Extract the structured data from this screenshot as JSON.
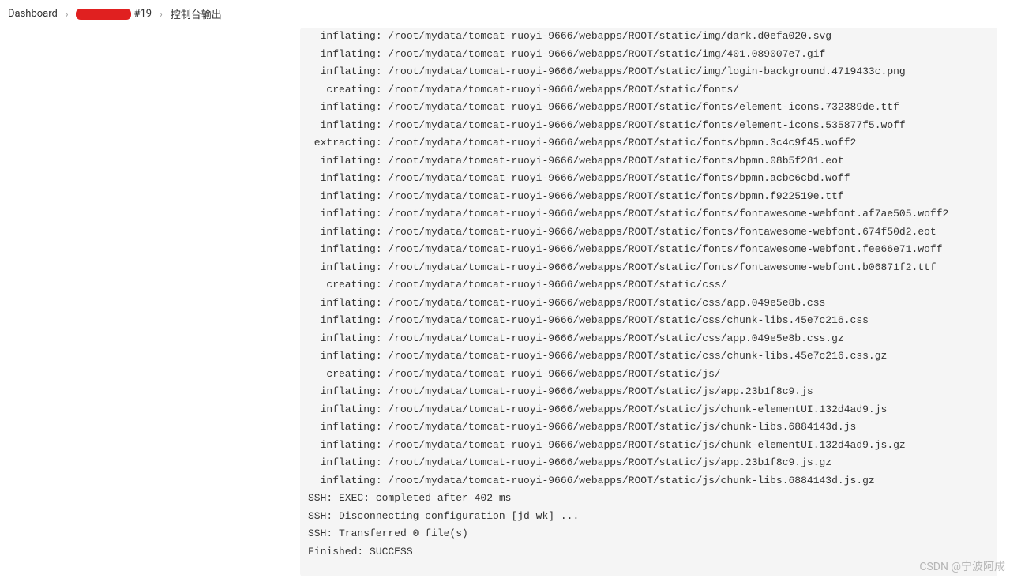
{
  "breadcrumb": {
    "items": [
      {
        "label": "Dashboard",
        "redacted": false
      },
      {
        "label": "#19",
        "redacted": true
      },
      {
        "label": "控制台输出",
        "redacted": false
      }
    ],
    "separator": "›"
  },
  "console": {
    "lines": [
      "  inflating: /root/mydata/tomcat-ruoyi-9666/webapps/ROOT/static/img/dark.d0efa020.svg",
      "  inflating: /root/mydata/tomcat-ruoyi-9666/webapps/ROOT/static/img/401.089007e7.gif",
      "  inflating: /root/mydata/tomcat-ruoyi-9666/webapps/ROOT/static/img/login-background.4719433c.png",
      "   creating: /root/mydata/tomcat-ruoyi-9666/webapps/ROOT/static/fonts/",
      "  inflating: /root/mydata/tomcat-ruoyi-9666/webapps/ROOT/static/fonts/element-icons.732389de.ttf",
      "  inflating: /root/mydata/tomcat-ruoyi-9666/webapps/ROOT/static/fonts/element-icons.535877f5.woff",
      " extracting: /root/mydata/tomcat-ruoyi-9666/webapps/ROOT/static/fonts/bpmn.3c4c9f45.woff2",
      "  inflating: /root/mydata/tomcat-ruoyi-9666/webapps/ROOT/static/fonts/bpmn.08b5f281.eot",
      "  inflating: /root/mydata/tomcat-ruoyi-9666/webapps/ROOT/static/fonts/bpmn.acbc6cbd.woff",
      "  inflating: /root/mydata/tomcat-ruoyi-9666/webapps/ROOT/static/fonts/bpmn.f922519e.ttf",
      "  inflating: /root/mydata/tomcat-ruoyi-9666/webapps/ROOT/static/fonts/fontawesome-webfont.af7ae505.woff2",
      "  inflating: /root/mydata/tomcat-ruoyi-9666/webapps/ROOT/static/fonts/fontawesome-webfont.674f50d2.eot",
      "  inflating: /root/mydata/tomcat-ruoyi-9666/webapps/ROOT/static/fonts/fontawesome-webfont.fee66e71.woff",
      "  inflating: /root/mydata/tomcat-ruoyi-9666/webapps/ROOT/static/fonts/fontawesome-webfont.b06871f2.ttf",
      "   creating: /root/mydata/tomcat-ruoyi-9666/webapps/ROOT/static/css/",
      "  inflating: /root/mydata/tomcat-ruoyi-9666/webapps/ROOT/static/css/app.049e5e8b.css",
      "  inflating: /root/mydata/tomcat-ruoyi-9666/webapps/ROOT/static/css/chunk-libs.45e7c216.css",
      "  inflating: /root/mydata/tomcat-ruoyi-9666/webapps/ROOT/static/css/app.049e5e8b.css.gz",
      "  inflating: /root/mydata/tomcat-ruoyi-9666/webapps/ROOT/static/css/chunk-libs.45e7c216.css.gz",
      "   creating: /root/mydata/tomcat-ruoyi-9666/webapps/ROOT/static/js/",
      "  inflating: /root/mydata/tomcat-ruoyi-9666/webapps/ROOT/static/js/app.23b1f8c9.js",
      "  inflating: /root/mydata/tomcat-ruoyi-9666/webapps/ROOT/static/js/chunk-elementUI.132d4ad9.js",
      "  inflating: /root/mydata/tomcat-ruoyi-9666/webapps/ROOT/static/js/chunk-libs.6884143d.js",
      "  inflating: /root/mydata/tomcat-ruoyi-9666/webapps/ROOT/static/js/chunk-elementUI.132d4ad9.js.gz",
      "  inflating: /root/mydata/tomcat-ruoyi-9666/webapps/ROOT/static/js/app.23b1f8c9.js.gz",
      "  inflating: /root/mydata/tomcat-ruoyi-9666/webapps/ROOT/static/js/chunk-libs.6884143d.js.gz",
      "SSH: EXEC: completed after 402 ms",
      "SSH: Disconnecting configuration [jd_wk] ...",
      "SSH: Transferred 0 file(s)",
      "Finished: SUCCESS"
    ]
  },
  "watermark": "CSDN @宁波阿成"
}
